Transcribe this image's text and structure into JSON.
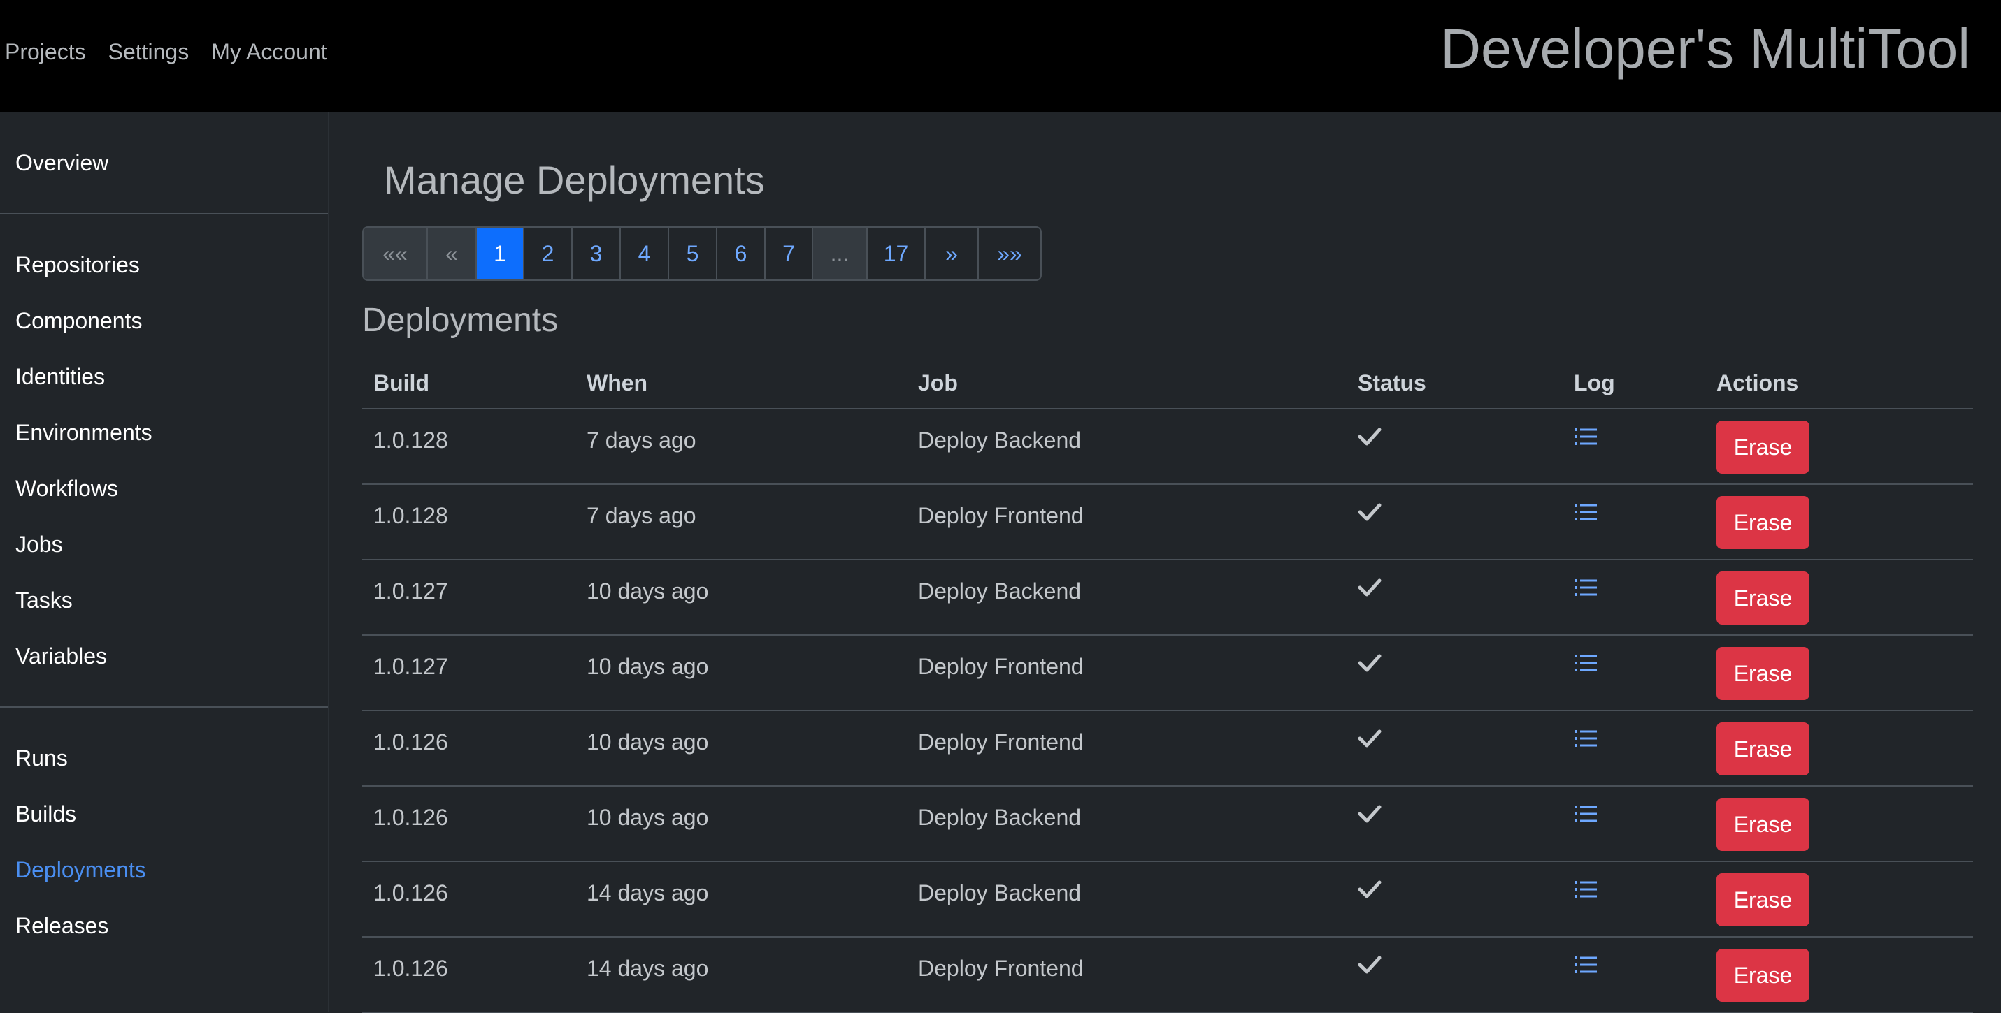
{
  "topnav": {
    "links": [
      "Projects",
      "Settings",
      "My Account"
    ],
    "brand": "Developer's MultiTool"
  },
  "sidebar": {
    "groups": [
      [
        "Overview"
      ],
      [
        "Repositories",
        "Components",
        "Identities",
        "Environments",
        "Workflows",
        "Jobs",
        "Tasks",
        "Variables"
      ],
      [
        "Runs",
        "Builds",
        "Deployments",
        "Releases"
      ]
    ],
    "active": "Deployments"
  },
  "page": {
    "title": "Manage Deployments",
    "section": "Deployments"
  },
  "pagination": {
    "items": [
      "««",
      "«",
      "1",
      "2",
      "3",
      "4",
      "5",
      "6",
      "7",
      "...",
      "17",
      "»",
      "»»"
    ],
    "current": "1",
    "disabled": [
      "««",
      "«",
      "..."
    ]
  },
  "table": {
    "columns": [
      "Build",
      "When",
      "Job",
      "Status",
      "Log",
      "Actions"
    ],
    "rows": [
      {
        "build": "1.0.128",
        "when": "7 days ago",
        "job": "Deploy Backend",
        "status": "success",
        "action": "Erase"
      },
      {
        "build": "1.0.128",
        "when": "7 days ago",
        "job": "Deploy Frontend",
        "status": "success",
        "action": "Erase"
      },
      {
        "build": "1.0.127",
        "when": "10 days ago",
        "job": "Deploy Backend",
        "status": "success",
        "action": "Erase"
      },
      {
        "build": "1.0.127",
        "when": "10 days ago",
        "job": "Deploy Frontend",
        "status": "success",
        "action": "Erase"
      },
      {
        "build": "1.0.126",
        "when": "10 days ago",
        "job": "Deploy Frontend",
        "status": "success",
        "action": "Erase"
      },
      {
        "build": "1.0.126",
        "when": "10 days ago",
        "job": "Deploy Backend",
        "status": "success",
        "action": "Erase"
      },
      {
        "build": "1.0.126",
        "when": "14 days ago",
        "job": "Deploy Backend",
        "status": "success",
        "action": "Erase"
      },
      {
        "build": "1.0.126",
        "when": "14 days ago",
        "job": "Deploy Frontend",
        "status": "success",
        "action": "Erase"
      }
    ]
  },
  "icons": {
    "status": "check-icon",
    "log": "list-icon"
  },
  "colors": {
    "accent": "#0d6efd",
    "link": "#6ea8fe",
    "danger": "#dc3545",
    "active_nav": "#4a8ef0"
  }
}
